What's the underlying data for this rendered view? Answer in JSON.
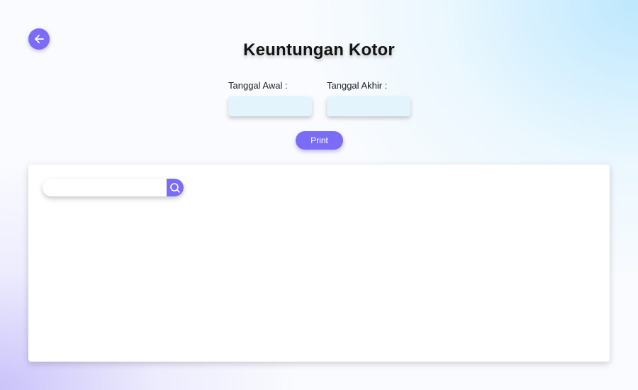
{
  "header": {
    "title": "Keuntungan Kotor",
    "back_icon": "arrow-left-icon"
  },
  "filters": {
    "start_date_label": "Tanggal Awal :",
    "start_date_value": "",
    "end_date_label": "Tanggal Akhir :",
    "end_date_value": "",
    "print_label": "Print"
  },
  "search": {
    "value": "",
    "icon": "search-icon"
  },
  "colors": {
    "accent": "#7b6cf6",
    "input_bg": "#e3f4fd",
    "title": "#141414"
  }
}
